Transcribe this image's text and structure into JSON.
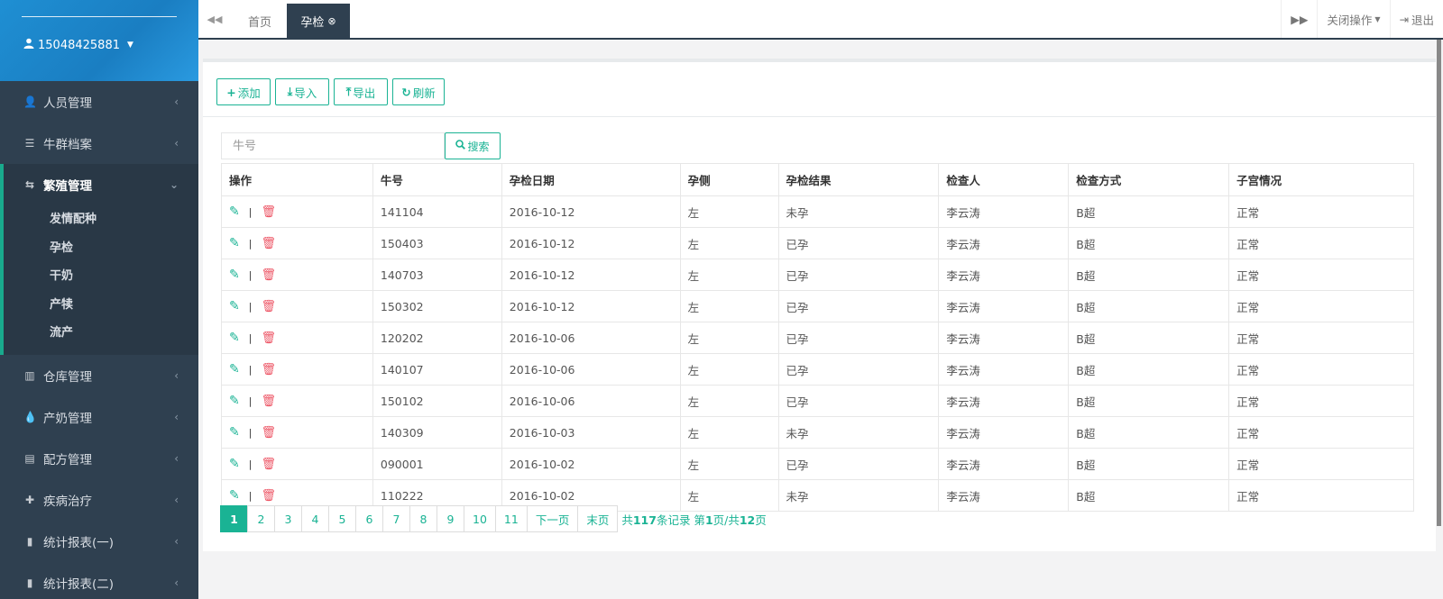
{
  "user": {
    "name": "15048425881"
  },
  "sidebar": {
    "items": [
      {
        "label": "人员管理",
        "icon": "user-icon"
      },
      {
        "label": "牛群档案",
        "icon": "list-icon"
      }
    ],
    "active_group": {
      "label": "繁殖管理",
      "icon": "retweet-icon",
      "children": [
        "发情配种",
        "孕检",
        "干奶",
        "产犊",
        "流产"
      ]
    },
    "items_after": [
      {
        "label": "仓库管理",
        "icon": "bar-chart-icon"
      },
      {
        "label": "产奶管理",
        "icon": "droplet-icon"
      },
      {
        "label": "配方管理",
        "icon": "document-icon"
      },
      {
        "label": "疾病治疗",
        "icon": "medicine-icon"
      },
      {
        "label": "统计报表(一)",
        "icon": "stats-icon"
      },
      {
        "label": "统计报表(二)",
        "icon": "stats-icon"
      }
    ]
  },
  "tabs": {
    "home": "首页",
    "active": "孕检"
  },
  "topbar": {
    "close_ops": "关闭操作",
    "logout": "退出"
  },
  "toolbar": {
    "add": "添加",
    "import": "导入",
    "export": "导出",
    "refresh": "刷新"
  },
  "search": {
    "placeholder": "牛号",
    "button": "搜索"
  },
  "table": {
    "columns": [
      "操作",
      "牛号",
      "孕检日期",
      "孕侧",
      "孕检结果",
      "检查人",
      "检查方式",
      "子宫情况"
    ],
    "rows": [
      [
        "141104",
        "2016-10-12",
        "左",
        "未孕",
        "李云涛",
        "B超",
        "正常"
      ],
      [
        "150403",
        "2016-10-12",
        "左",
        "已孕",
        "李云涛",
        "B超",
        "正常"
      ],
      [
        "140703",
        "2016-10-12",
        "左",
        "已孕",
        "李云涛",
        "B超",
        "正常"
      ],
      [
        "150302",
        "2016-10-12",
        "左",
        "已孕",
        "李云涛",
        "B超",
        "正常"
      ],
      [
        "120202",
        "2016-10-06",
        "左",
        "已孕",
        "李云涛",
        "B超",
        "正常"
      ],
      [
        "140107",
        "2016-10-06",
        "左",
        "已孕",
        "李云涛",
        "B超",
        "正常"
      ],
      [
        "150102",
        "2016-10-06",
        "左",
        "已孕",
        "李云涛",
        "B超",
        "正常"
      ],
      [
        "140309",
        "2016-10-03",
        "左",
        "未孕",
        "李云涛",
        "B超",
        "正常"
      ],
      [
        "090001",
        "2016-10-02",
        "左",
        "已孕",
        "李云涛",
        "B超",
        "正常"
      ],
      [
        "110222",
        "2016-10-02",
        "左",
        "未孕",
        "李云涛",
        "B超",
        "正常"
      ]
    ],
    "op_separator": "|"
  },
  "pagination": {
    "pages": [
      "1",
      "2",
      "3",
      "4",
      "5",
      "6",
      "7",
      "8",
      "9",
      "10",
      "11"
    ],
    "current": "1",
    "next": "下一页",
    "last": "末页",
    "info_prefix": "共",
    "total": "117",
    "info_mid": "条记录 第",
    "page": "1",
    "info_mid2": "页/共",
    "total_pages": "12",
    "info_suffix": "页"
  },
  "colors": {
    "accent": "#1ab394",
    "sidebar": "#2f4050",
    "danger": "#ed5565",
    "header": "#1f8fd3"
  }
}
